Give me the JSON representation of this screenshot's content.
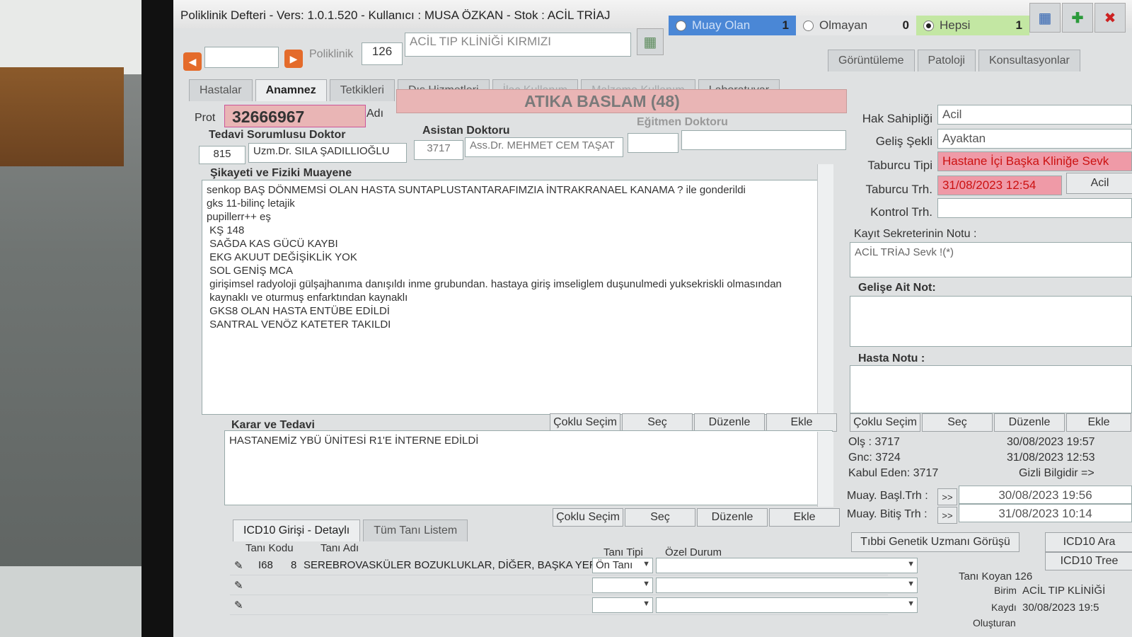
{
  "window": {
    "title": "Poliklinik Defteri - Vers: 1.0.1.520 - Kullanıcı : MUSA ÖZKAN - Stok : ACİL TRİAJ"
  },
  "filters": {
    "bugun_olan_label": "Muay Olan",
    "bugun_olan_count": "1",
    "olmayan_label": "Olmayan",
    "olmayan_count": "0",
    "hepsi_label": "Hepsi",
    "hepsi_count": "1"
  },
  "poliklinik": {
    "label": "Poliklinik",
    "code": "126",
    "name": "ACİL TIP KLİNİĞİ KIRMIZI"
  },
  "tabs_top": [
    "Görüntüleme",
    "Patoloji",
    "Konsultasyonlar"
  ],
  "tabs_main": [
    {
      "label": "Hastalar",
      "state": "normal"
    },
    {
      "label": "Anamnez",
      "state": "active"
    },
    {
      "label": "Tetkikleri",
      "state": "normal"
    },
    {
      "label": "Dış Hizmetleri",
      "state": "normal"
    },
    {
      "label": "İlaç Kullanım",
      "state": "dim"
    },
    {
      "label": "Malzeme Kullanım",
      "state": "dim"
    },
    {
      "label": "Laboratuvar",
      "state": "normal"
    }
  ],
  "patient": {
    "prot_label": "Prot",
    "prot_no": "32666967",
    "adi_label": "Adı",
    "name": "ATIKA BASLAM (48)"
  },
  "doctors": {
    "tedavi_label": "Tedavi Sorumlusu Doktor",
    "tedavi_code": "815",
    "tedavi_name": "Uzm.Dr. SILA ŞADILLIOĞLU",
    "asistan_label": "Asistan Doktoru",
    "asistan_code": "3717",
    "asistan_name": "Ass.Dr. MEHMET CEM TAŞAT",
    "egitmen_label": "Eğitmen Doktoru"
  },
  "complaint": {
    "label": "Şikayeti ve Fiziki Muayene",
    "lines": [
      "senkop BAŞ DÖNMEMSİ OLAN HASTA SUNTAPLUSTANTARAFIMZIA İNTRAKRANAEL KANAMA ? ile gonderildi",
      "gks 11-bilinç letajik",
      "pupillerr++ eş",
      " KŞ 148",
      " SAĞDA KAS GÜCÜ KAYBI",
      " EKG AKUUT DEĞİŞİKLİK YOK",
      " SOL GENİŞ MCA",
      " girişimsel radyoloji gülşajhanıma danışıldı inme grubundan. hastaya giriş imseliglem duşunulmedi yuksekriskli olmasından",
      " kaynaklı ve oturmuş enfarktından kaynaklı",
      "",
      " GKS8 OLAN HASTA ENTÜBE EDİLDİ",
      "",
      " SANTRAL VENÖZ KATETER TAKILDI"
    ]
  },
  "buttons": {
    "coklu_secim": "Çoklu Seçim",
    "sec": "Seç",
    "duzenle": "Düzenle",
    "ekle": "Ekle"
  },
  "karar": {
    "label": "Karar ve Tedavi",
    "text": "HASTANEMİZ YBÜ ÜNİTESİ R1'E İNTERNE EDİLDİ"
  },
  "diagnosis": {
    "tab_detay": "ICD10 Girişi - Detaylı",
    "tab_tum": "Tüm Tanı Listem",
    "col_kodu": "Tanı Kodu",
    "col_adi": "Tanı Adı",
    "col_tipi": "Tanı Tipi",
    "col_ozel": "Özel Durum",
    "row_code": "I68",
    "row_sub": "8",
    "row_name": "SEREBROVASKÜLER BOZUKLUKLAR, DİĞER, BAŞKA YERDE",
    "row_tipi": "Ön Tanı"
  },
  "right": {
    "hak_label": "Hak Sahipliği",
    "hak_value": "Acil",
    "gelis_label": "Geliş Şekli",
    "gelis_value": "Ayaktan",
    "taburcu_tipi_label": "Taburcu Tipi",
    "taburcu_tipi_value": "Hastane İçi Başka Kliniğe Sevk",
    "taburcu_trh_label": "Taburcu Trh.",
    "taburcu_trh_value": "31/08/2023 12:54",
    "acil_btn": "Acil",
    "kontrol_label": "Kontrol Trh.",
    "kayit_label": "Kayıt Sekreterinin Notu :",
    "kayit_value": "ACİL TRİAJ Sevk !(*)",
    "gelise_label": "Gelişe Ait Not:",
    "hasta_notu_label": "Hasta Notu :",
    "ols_label": "Olş : 3717",
    "ols_date": "30/08/2023 19:57",
    "gnc_label": "Gnc: 3724",
    "gnc_date": "31/08/2023 12:53",
    "kabul_label": "Kabul Eden: 3717",
    "gizli": "Gizli Bilgidir =>",
    "muay_basl_label": "Muay. Başl.Trh :",
    "muay_basl_value": "30/08/2023 19:56",
    "muay_bitis_label": "Muay. Bitiş Trh :",
    "muay_bitis_value": "31/08/2023 10:14",
    "genetik_btn": "Tıbbi Genetik Uzmanı Görüşü",
    "icd_ara": "ICD10 Ara",
    "icd_tree": "ICD10 Tree",
    "tani_koyan": "Tanı Koyan 126",
    "birim_label": "Birim",
    "birim_value": "ACİL TIP KLİNİĞİ",
    "kaydi_label": "Kaydı",
    "kaydi_value": "30/08/2023 19:5",
    "olusturan_label": "Oluşturan"
  }
}
